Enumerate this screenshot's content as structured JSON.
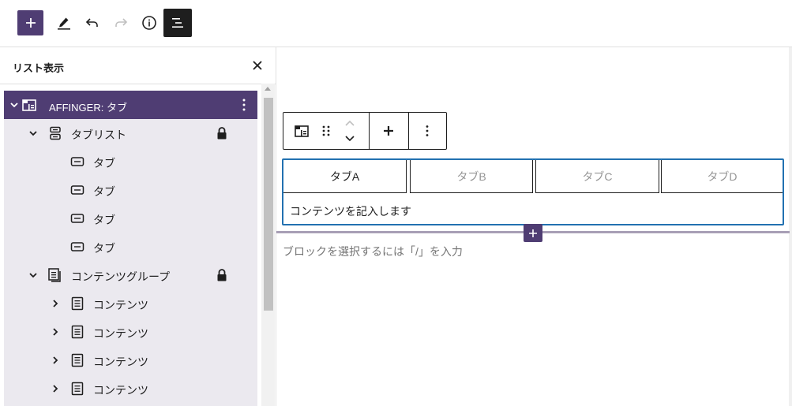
{
  "toolbar": {
    "add_icon": "plus-icon",
    "tools_icon": "pencil-icon",
    "undo_icon": "undo-icon",
    "redo_icon": "redo-icon",
    "info_icon": "info-icon",
    "list_view_icon": "list-view-icon"
  },
  "panel": {
    "title": "リスト表示",
    "close_icon": "close-icon",
    "items": [
      {
        "label": "AFFINGER: タブ",
        "selected": true,
        "expanded": true,
        "icon": "tabs-block-icon"
      },
      {
        "label": "タブリスト",
        "expanded": true,
        "locked": true,
        "icon": "tab-list-icon"
      },
      {
        "label": "タブ",
        "icon": "tab-item-icon"
      },
      {
        "label": "タブ",
        "icon": "tab-item-icon"
      },
      {
        "label": "タブ",
        "icon": "tab-item-icon"
      },
      {
        "label": "タブ",
        "icon": "tab-item-icon"
      },
      {
        "label": "コンテンツグループ",
        "expanded": true,
        "locked": true,
        "icon": "content-group-icon"
      },
      {
        "label": "コンテンツ",
        "expanded": false,
        "icon": "content-icon"
      },
      {
        "label": "コンテンツ",
        "expanded": false,
        "icon": "content-icon"
      },
      {
        "label": "コンテンツ",
        "expanded": false,
        "icon": "content-icon"
      },
      {
        "label": "コンテンツ",
        "expanded": false,
        "icon": "content-icon"
      }
    ]
  },
  "editor": {
    "block_toolbar": {
      "block_icon": "tabs-block-icon",
      "drag_icon": "drag-handle-icon",
      "move_up_icon": "chevron-up-icon",
      "move_down_icon": "chevron-down-icon",
      "add_icon": "plus-icon",
      "options_icon": "more-vertical-icon"
    },
    "tabs": [
      {
        "label": "タブA",
        "active": true
      },
      {
        "label": "タブB",
        "active": false
      },
      {
        "label": "タブC",
        "active": false
      },
      {
        "label": "タブD",
        "active": false
      }
    ],
    "tab_content": "コンテンツを記入します",
    "placeholder": "ブロックを選択するには「/」を入力"
  },
  "colors": {
    "accent": "#4f3d73",
    "selection_border": "#2271b1",
    "tree_background": "#ebe9ef"
  }
}
